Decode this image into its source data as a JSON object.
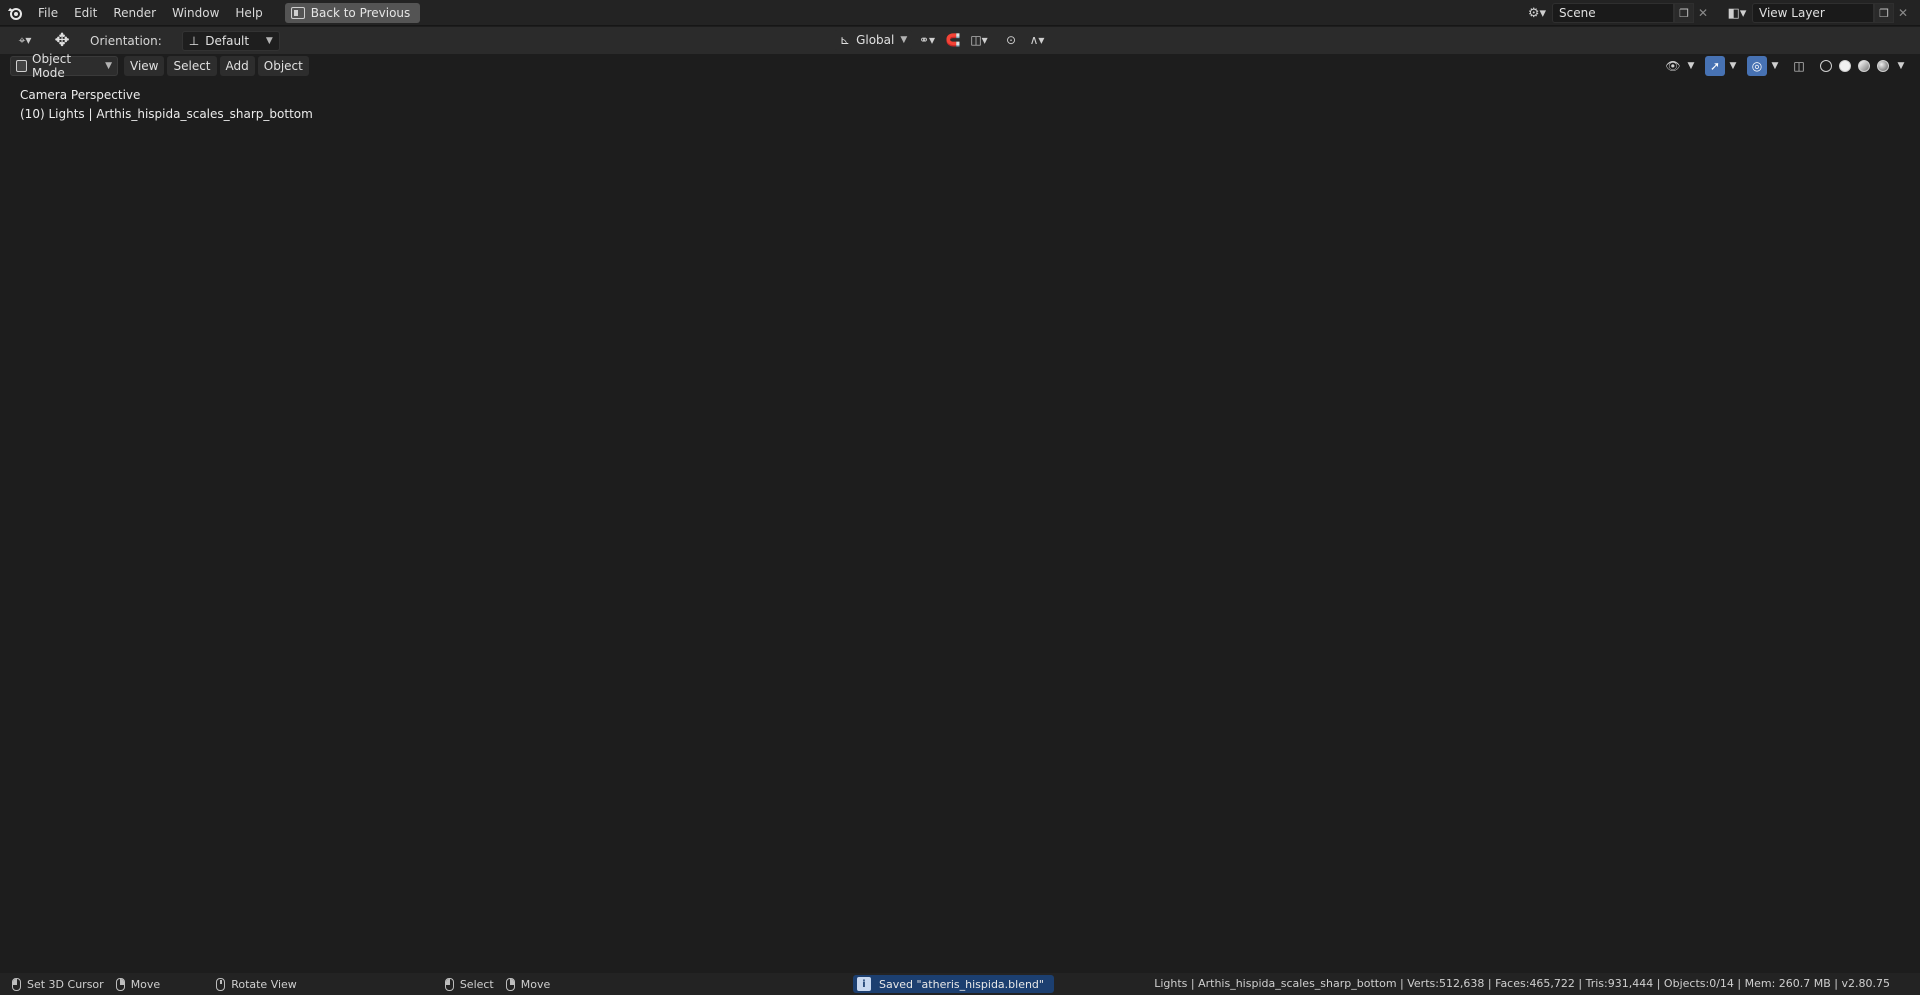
{
  "menu": {
    "items": [
      "File",
      "Edit",
      "Render",
      "Window",
      "Help"
    ],
    "back_button": "Back to Previous"
  },
  "scene": {
    "name": "Scene"
  },
  "view_layer": {
    "name": "View Layer"
  },
  "toolbar": {
    "orientation_label": "Orientation:",
    "orientation_value": "Default",
    "transform_space": "Global"
  },
  "viewport_header": {
    "mode": "Object Mode",
    "menus": [
      "View",
      "Select",
      "Add",
      "Object"
    ]
  },
  "viewport": {
    "perspective_label": "Camera Perspective",
    "active_object": "(10) Lights | Arthis_hispida_scales_sharp_bottom"
  },
  "statusbar": {
    "hints": [
      {
        "mouse": "left",
        "label": "Set 3D Cursor"
      },
      {
        "mouse": "right",
        "label": "Move"
      },
      {
        "mouse": "middle",
        "label": "Rotate View"
      },
      {
        "mouse": "left",
        "label": "Select"
      },
      {
        "mouse": "right",
        "label": "Move"
      }
    ],
    "saved_message": "Saved \"atheris_hispida.blend\"",
    "stats": "Lights | Arthis_hispida_scales_sharp_bottom | Verts:512,638 | Faces:465,722 | Tris:931,444 | Objects:0/14 | Mem: 260.7 MB | v2.80.75"
  },
  "colors": {
    "active_blue": "#4772b3",
    "x_axis": "#c0394f",
    "y_axis": "#7a9a2a",
    "light_gizmo": "#d8d86a",
    "saved_bg": "#1c3f70"
  }
}
